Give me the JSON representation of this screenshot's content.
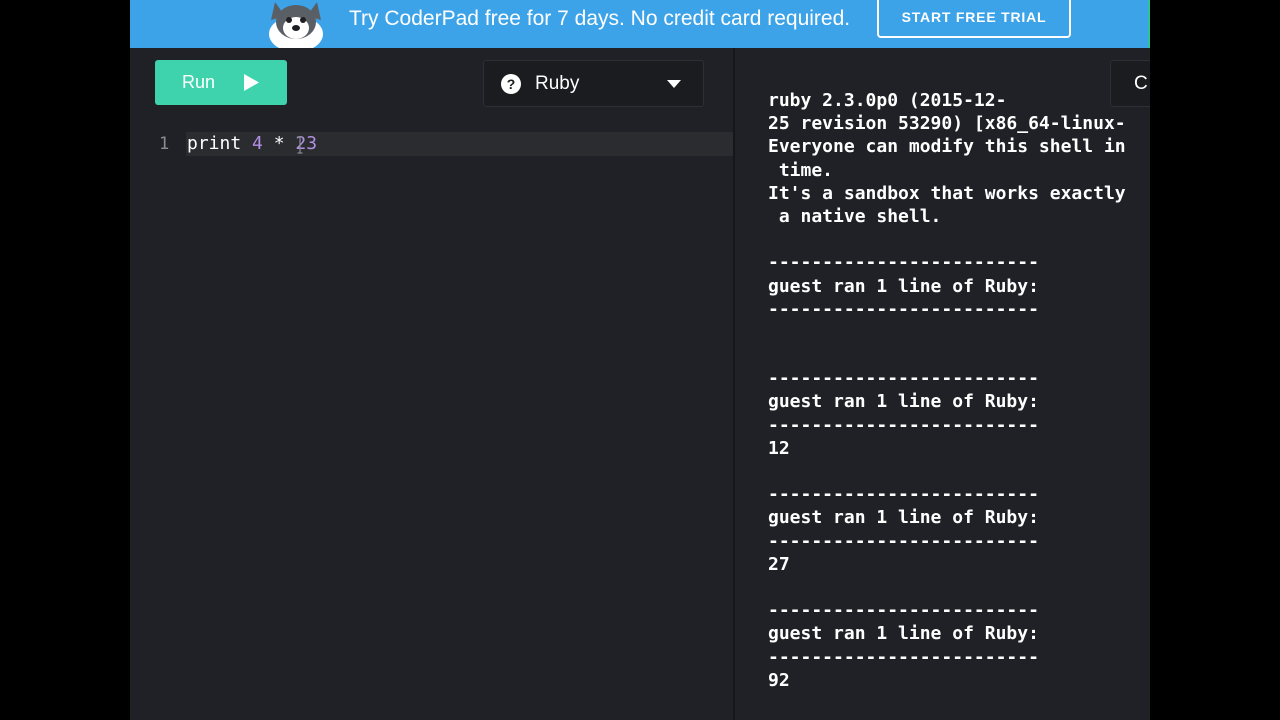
{
  "banner": {
    "text": "Try CoderPad free for 7 days. No credit card required.",
    "cta_label": "START FREE TRIAL"
  },
  "editor": {
    "run_label": "Run",
    "language": "Ruby",
    "line_number": "1",
    "code": {
      "keyword": "print",
      "num1": "4",
      "operator": "*",
      "num2": "23"
    }
  },
  "output": {
    "clear_label": "C",
    "console_lines": [
      "ruby 2.3.0p0 (2015-12-",
      "25 revision 53290) [x86_64-linux-",
      "Everyone can modify this shell in",
      " time.",
      "It's a sandbox that works exactly",
      " a native shell.",
      "",
      "-------------------------",
      "guest ran 1 line of Ruby:",
      "-------------------------",
      "",
      "",
      "-------------------------",
      "guest ran 1 line of Ruby:",
      "-------------------------",
      "12",
      "",
      "-------------------------",
      "guest ran 1 line of Ruby:",
      "-------------------------",
      "27",
      "",
      "-------------------------",
      "guest ran 1 line of Ruby:",
      "-------------------------",
      "92",
      "",
      "..."
    ]
  },
  "colors": {
    "banner": "#3da3e8",
    "run": "#3fd3ad",
    "background": "#1f2126",
    "number": "#b18fe3"
  }
}
